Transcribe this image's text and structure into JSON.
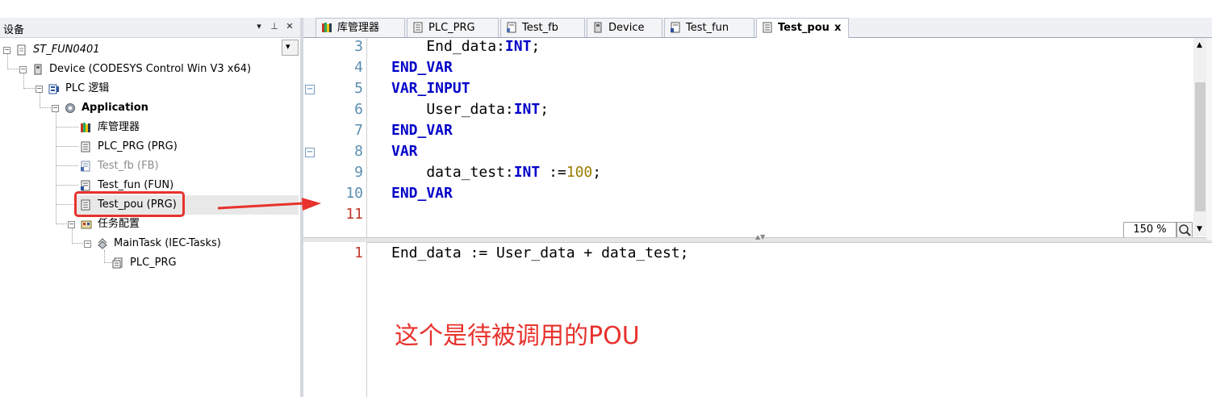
{
  "panel": {
    "title": "设备",
    "pin_glyph": "▾",
    "auto_hide_glyph": "⊥",
    "close_glyph": "✕",
    "dropdown_glyph": "▾"
  },
  "tree": {
    "items": [
      {
        "label": "ST_FUN0401",
        "icon": "project-icon"
      },
      {
        "label": "Device (CODESYS Control Win V3 x64)",
        "icon": "device-icon"
      },
      {
        "label": "PLC 逻辑",
        "icon": "plc-logic-icon"
      },
      {
        "label": "Application",
        "icon": "application-gear-icon"
      },
      {
        "label": "库管理器",
        "icon": "library-manager-icon"
      },
      {
        "label": "PLC_PRG (PRG)",
        "icon": "pou-program-icon"
      },
      {
        "label": "Test_fb (FB)",
        "icon": "pou-function-block-icon"
      },
      {
        "label": "Test_fun (FUN)",
        "icon": "pou-function-icon"
      },
      {
        "label": "Test_pou (PRG)",
        "icon": "pou-program-icon"
      },
      {
        "label": "任务配置",
        "icon": "task-config-icon"
      },
      {
        "label": "MainTask (IEC-Tasks)",
        "icon": "task-icon"
      },
      {
        "label": "PLC_PRG",
        "icon": "program-call-icon"
      }
    ]
  },
  "tabs": [
    {
      "label": "库管理器",
      "icon": "library-manager-icon"
    },
    {
      "label": "PLC_PRG",
      "icon": "pou-program-icon"
    },
    {
      "label": "Test_fb",
      "icon": "pou-function-block-icon"
    },
    {
      "label": "Device",
      "icon": "device-icon"
    },
    {
      "label": "Test_fun",
      "icon": "pou-function-icon"
    },
    {
      "label": "Test_pou",
      "icon": "pou-program-icon",
      "close": "x"
    }
  ],
  "declaration": {
    "lines": [
      {
        "num": "3",
        "parts": [
          {
            "t": "    End_data:",
            "c": "plain"
          },
          {
            "t": "INT",
            "c": "kw"
          },
          {
            "t": ";",
            "c": "plain"
          }
        ]
      },
      {
        "num": "4",
        "parts": [
          {
            "t": "END_VAR",
            "c": "kw"
          }
        ]
      },
      {
        "num": "5",
        "parts": [
          {
            "t": "VAR_INPUT",
            "c": "kw"
          }
        ],
        "fold": "⊟"
      },
      {
        "num": "6",
        "parts": [
          {
            "t": "    User_data:",
            "c": "plain"
          },
          {
            "t": "INT",
            "c": "kw"
          },
          {
            "t": ";",
            "c": "plain"
          }
        ]
      },
      {
        "num": "7",
        "parts": [
          {
            "t": "END_VAR",
            "c": "kw"
          }
        ]
      },
      {
        "num": "8",
        "parts": [
          {
            "t": "VAR",
            "c": "kw"
          }
        ],
        "fold": "⊟"
      },
      {
        "num": "9",
        "parts": [
          {
            "t": "    data_test:",
            "c": "plain"
          },
          {
            "t": "INT",
            "c": "kw"
          },
          {
            "t": " :=",
            "c": "plain"
          },
          {
            "t": "100",
            "c": "num"
          },
          {
            "t": ";",
            "c": "plain"
          }
        ]
      },
      {
        "num": "10",
        "parts": [
          {
            "t": "END_VAR",
            "c": "kw"
          }
        ]
      },
      {
        "num": "11",
        "parts": []
      }
    ],
    "zoom": "150 %"
  },
  "implementation": {
    "lines": [
      {
        "num": "1",
        "parts": [
          {
            "t": "End_data := User_data + data_test;",
            "c": "plain"
          }
        ]
      }
    ]
  },
  "annotation": "这个是待被调用的POU",
  "colors": {
    "keyword": "#0000c8",
    "number": "#9a7d00",
    "line_number": "#5b8fb0",
    "last_line_number": "#c0392b",
    "annotation": "#e8322d"
  }
}
